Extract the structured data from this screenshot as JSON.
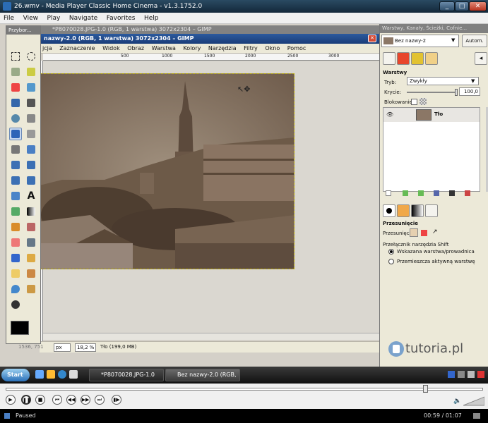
{
  "mpc": {
    "title": "26.wmv - Media Player Classic Home Cinema - v1.3.1752.0",
    "menu": [
      "File",
      "View",
      "Play",
      "Navigate",
      "Favorites",
      "Help"
    ],
    "status": "Paused",
    "time": "00:59 / 01:07",
    "seek_fraction": 0.88
  },
  "gimp": {
    "toolbox_title": "Przybor...",
    "image_tab": "*P8070028.JPG-1.0 (RGB, 1 warstwa) 3072x2304 – GIMP",
    "image_title": "nazwy-2.0 (RGB, 1 warstwa) 3072x2304 – GIMP",
    "menu": [
      "jcja",
      "Zaznaczenie",
      "Widok",
      "Obraz",
      "Warstwa",
      "Kolory",
      "Narzędzia",
      "Filtry",
      "Okno",
      "Pomoc"
    ],
    "ruler_ticks": [
      "500",
      "1000",
      "1500",
      "2000",
      "2500",
      "3000"
    ],
    "status": {
      "coords": "1536, 751",
      "unit": "px",
      "zoom": "18,2 %",
      "info": "Tło (199,0 MB)"
    }
  },
  "dock": {
    "title": "Warstwy, Kanały, Ścieżki, Cofnie...",
    "image_select": "Bez nazwy-2",
    "auto_button": "Autom.",
    "layers_heading": "Warstwy",
    "mode_label": "Tryb:",
    "mode_value": "Zwykły",
    "opacity_label": "Krycie:",
    "opacity_value": "100,0",
    "lock_label": "Blokowanie:",
    "layer_name": "Tło",
    "tool_heading": "Przesunięcie",
    "tool_option_label": "Przesunięcie:",
    "switch_label": "Przełącznik narzędzia",
    "switch_key": "Shift",
    "radio1": "Wskazana warstwa/prowadnica",
    "radio2": "Przemieszcza aktywną warstwę",
    "watermark": "tutoria.pl"
  },
  "taskbar": {
    "start": "Start",
    "task1": "*P8070028.JPG-1.0 (RGB...",
    "task2": "Bez nazwy-2.0 (RGB, ..."
  }
}
